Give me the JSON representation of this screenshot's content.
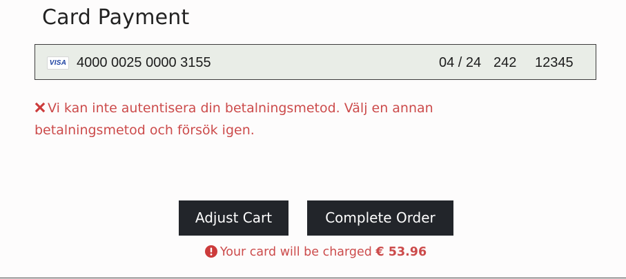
{
  "page": {
    "title": "Card Payment"
  },
  "card_field": {
    "brand_icon": "visa-icon",
    "brand_label": "VISA",
    "number": "4000 0025 0000 3155",
    "expiry": "04 / 24",
    "cvc": "242",
    "postal_code": "12345",
    "background_color": "#e9ede7"
  },
  "error": {
    "icon": "close-x-icon",
    "message": "Vi kan inte autentisera din betalningsmetod. Välj en annan betalningsmetod och försök igen.",
    "color": "#cc4b4b"
  },
  "actions": {
    "adjust_cart_label": "Adjust Cart",
    "complete_order_label": "Complete Order",
    "button_color": "#22252a"
  },
  "charge_notice": {
    "icon": "exclamation-circle-icon",
    "text": "Your card will be charged",
    "amount": "€ 53.96"
  }
}
